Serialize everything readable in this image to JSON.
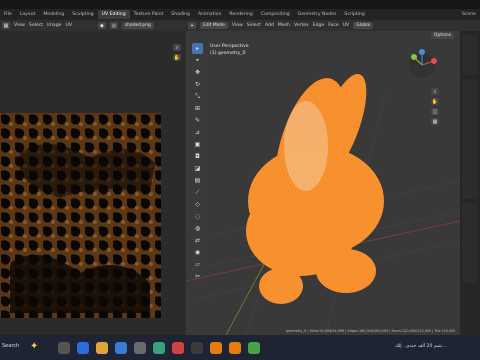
{
  "workspace_tabs": [
    "File",
    "Layout",
    "Modeling",
    "Sculpting",
    "UV Editing",
    "Texture Paint",
    "Shading",
    "Animation",
    "Rendering",
    "Compositing",
    "Geometry Nodes",
    "Scripting"
  ],
  "active_tab": "UV Editing",
  "scene_label": "Scene",
  "uv_header": {
    "menus": [
      "View",
      "Select",
      "Image",
      "UV"
    ],
    "image_name": "shaded.png"
  },
  "vp_header": {
    "mode": "Edit Mode",
    "menus": [
      "View",
      "Select",
      "Add",
      "Mesh",
      "Vertex",
      "Edge",
      "Face",
      "UV"
    ],
    "orientation": "Global",
    "options": "Options"
  },
  "viewport": {
    "perspective": "User Perspective",
    "object": "(1) geometry_0"
  },
  "gizmo": {
    "x": "X",
    "y": "Y",
    "z": "Z"
  },
  "status_bar": "geometry_0 | Verts:54,998/54,998 | Edges:180,000/180,000 | Faces:120,000/120,000 | Tris:120,000",
  "taskbar": {
    "search_text": "Search",
    "lang_text": "تضم 20 ألف جندي.. إلك..."
  },
  "colors": {
    "mesh": "#ff8a1e",
    "accent": "#4772b3",
    "grid": "#454545"
  }
}
